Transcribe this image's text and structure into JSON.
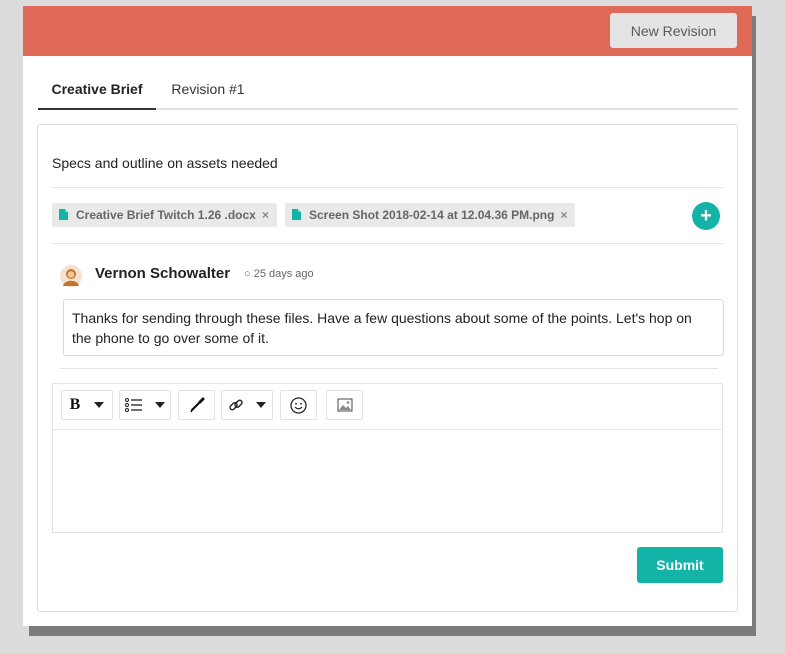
{
  "header": {
    "new_revision_label": "New Revision"
  },
  "tabs": [
    {
      "label": "Creative Brief",
      "active": true
    },
    {
      "label": "Revision #1",
      "active": false
    }
  ],
  "brief": {
    "description": "Specs and outline on assets needed",
    "attachments": [
      {
        "name": "Creative Brief Twitch 1.26 .docx",
        "remove": "×",
        "icon": "file-icon"
      },
      {
        "name": "Screen Shot 2018-02-14 at 12.04.36 PM.png",
        "remove": "×",
        "icon": "file-icon"
      }
    ],
    "add_label": "+"
  },
  "comment": {
    "author": "Vernon Schowalter",
    "time": "25 days ago",
    "text": "Thanks for sending through these files. Have a few questions about some of the points. Let's hop on the phone to go over some of it."
  },
  "editor": {
    "bold_label": "B",
    "value": ""
  },
  "actions": {
    "submit_label": "Submit"
  },
  "colors": {
    "header": "#e06a58",
    "accent": "#13b3a8",
    "chip_bg": "#e9e9e9"
  }
}
